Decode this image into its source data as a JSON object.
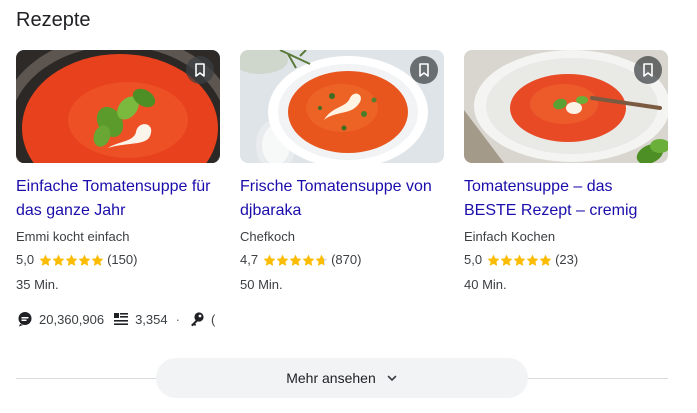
{
  "section": {
    "title": "Rezepte"
  },
  "cards": [
    {
      "title": "Einfache Tomatensuppe für das ganze Jahr",
      "source": "Emmi kocht einfach",
      "rating": "5,0",
      "stars": 5.0,
      "count": "(150)",
      "duration": "35 Min."
    },
    {
      "title": "Frische Tomatensuppe von djbaraka",
      "source": "Chefkoch",
      "rating": "4,7",
      "stars": 4.7,
      "count": "(870)",
      "duration": "50 Min."
    },
    {
      "title": "Tomatensuppe – das BESTE Rezept – cremig &…",
      "source": "Einfach Kochen",
      "rating": "5,0",
      "stars": 5.0,
      "count": "(23)",
      "duration": "40 Min."
    }
  ],
  "stats": {
    "views": "20,360,906",
    "items": "3,354",
    "sep": "·",
    "extra": "( "
  },
  "more_button": {
    "label": "Mehr ansehen"
  },
  "colors": {
    "link": "#1a0dab",
    "star": "#fbbc04",
    "button_bg": "#f1f3f4",
    "divider": "#dadce0"
  },
  "icons": {
    "bookmark": "bookmark-icon",
    "views": "chat-bubble-icon",
    "items": "list-icon",
    "extra": "key-icon",
    "chevron": "chevron-down-icon"
  }
}
